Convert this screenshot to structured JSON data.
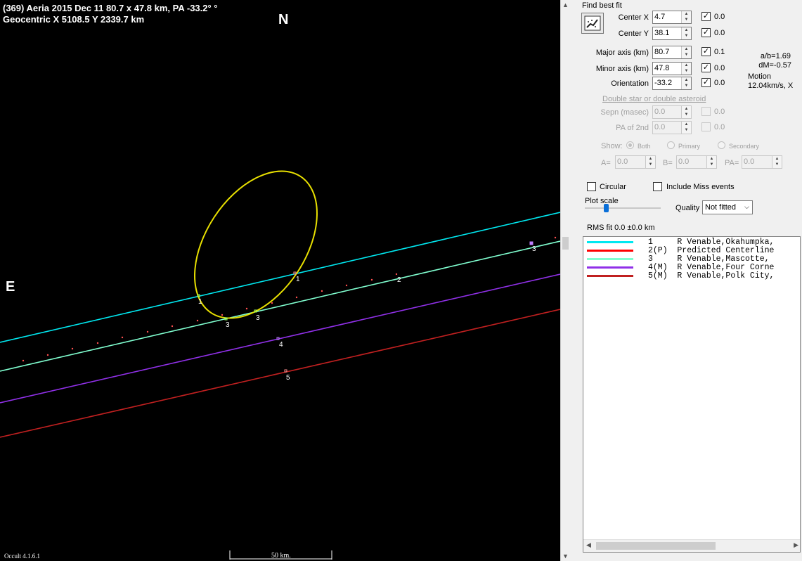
{
  "plot": {
    "title_line1": "(369) Aeria  2015 Dec 11  80.7 x 47.8 km, PA -33.2° °",
    "title_line2": "Geocentric  X  5108.5  Y 2339.7 km",
    "north_label": "N",
    "east_label": "E",
    "version": "Occult 4.1.6.1",
    "scale_label": "50 km.",
    "ellipse_color": "#e8e000",
    "chord_labels": [
      "1",
      "2",
      "3",
      "3",
      "1",
      "3",
      "4",
      "5"
    ]
  },
  "panel": {
    "find_best_fit_label": "Find best fit",
    "center_x": {
      "label": "Center X",
      "value": "4.7",
      "fit_value": "0.0",
      "checked": true
    },
    "center_y": {
      "label": "Center Y",
      "value": "38.1",
      "fit_value": "0.0",
      "checked": true
    },
    "major_axis": {
      "label": "Major axis (km)",
      "value": "80.7",
      "fit_value": "0.1",
      "checked": true
    },
    "minor_axis": {
      "label": "Minor axis (km)",
      "value": "47.8",
      "fit_value": "0.0",
      "checked": true
    },
    "orientation": {
      "label": "Orientation",
      "value": "-33.2",
      "fit_value": "0.0",
      "checked": true
    },
    "ab_ratio": "a/b=1.69",
    "dm": "dM=-0.57",
    "motion_label": "Motion",
    "motion_value": "12.04km/s, X",
    "double_star_label": "Double star  or  double asteroid",
    "sepn": {
      "label": "Sepn (masec)",
      "value": "0.0",
      "fit_value": "0.0"
    },
    "pa2nd": {
      "label": "PA of 2nd",
      "value": "0.0",
      "fit_value": "0.0"
    },
    "show_label": "Show:",
    "show_options": [
      "Both",
      "Primary",
      "Secondary"
    ],
    "a_label": "A=",
    "a_value": "0.0",
    "b_label": "B=",
    "b_value": "0.0",
    "pa_label": "PA=",
    "pa_value": "0.0",
    "circular_label": "Circular",
    "include_miss_label": "Include Miss events",
    "plot_scale_label": "Plot scale",
    "quality_label": "Quality",
    "quality_value": "Not fitted",
    "rms_fit": "RMS fit 0.0 ±0.0 km"
  },
  "legend": [
    {
      "color": "#00e8f0",
      "text": "1     R Venable,Okahumpka,"
    },
    {
      "color": "#ff0000",
      "text": "2(P)  Predicted Centerline"
    },
    {
      "color": "#80ffd0",
      "text": "3     R Venable,Mascotte,"
    },
    {
      "color": "#9030e8",
      "text": "4(M)  R Venable,Four Corne"
    },
    {
      "color": "#c02020",
      "text": "5(M)  R Venable,Polk City,"
    }
  ]
}
